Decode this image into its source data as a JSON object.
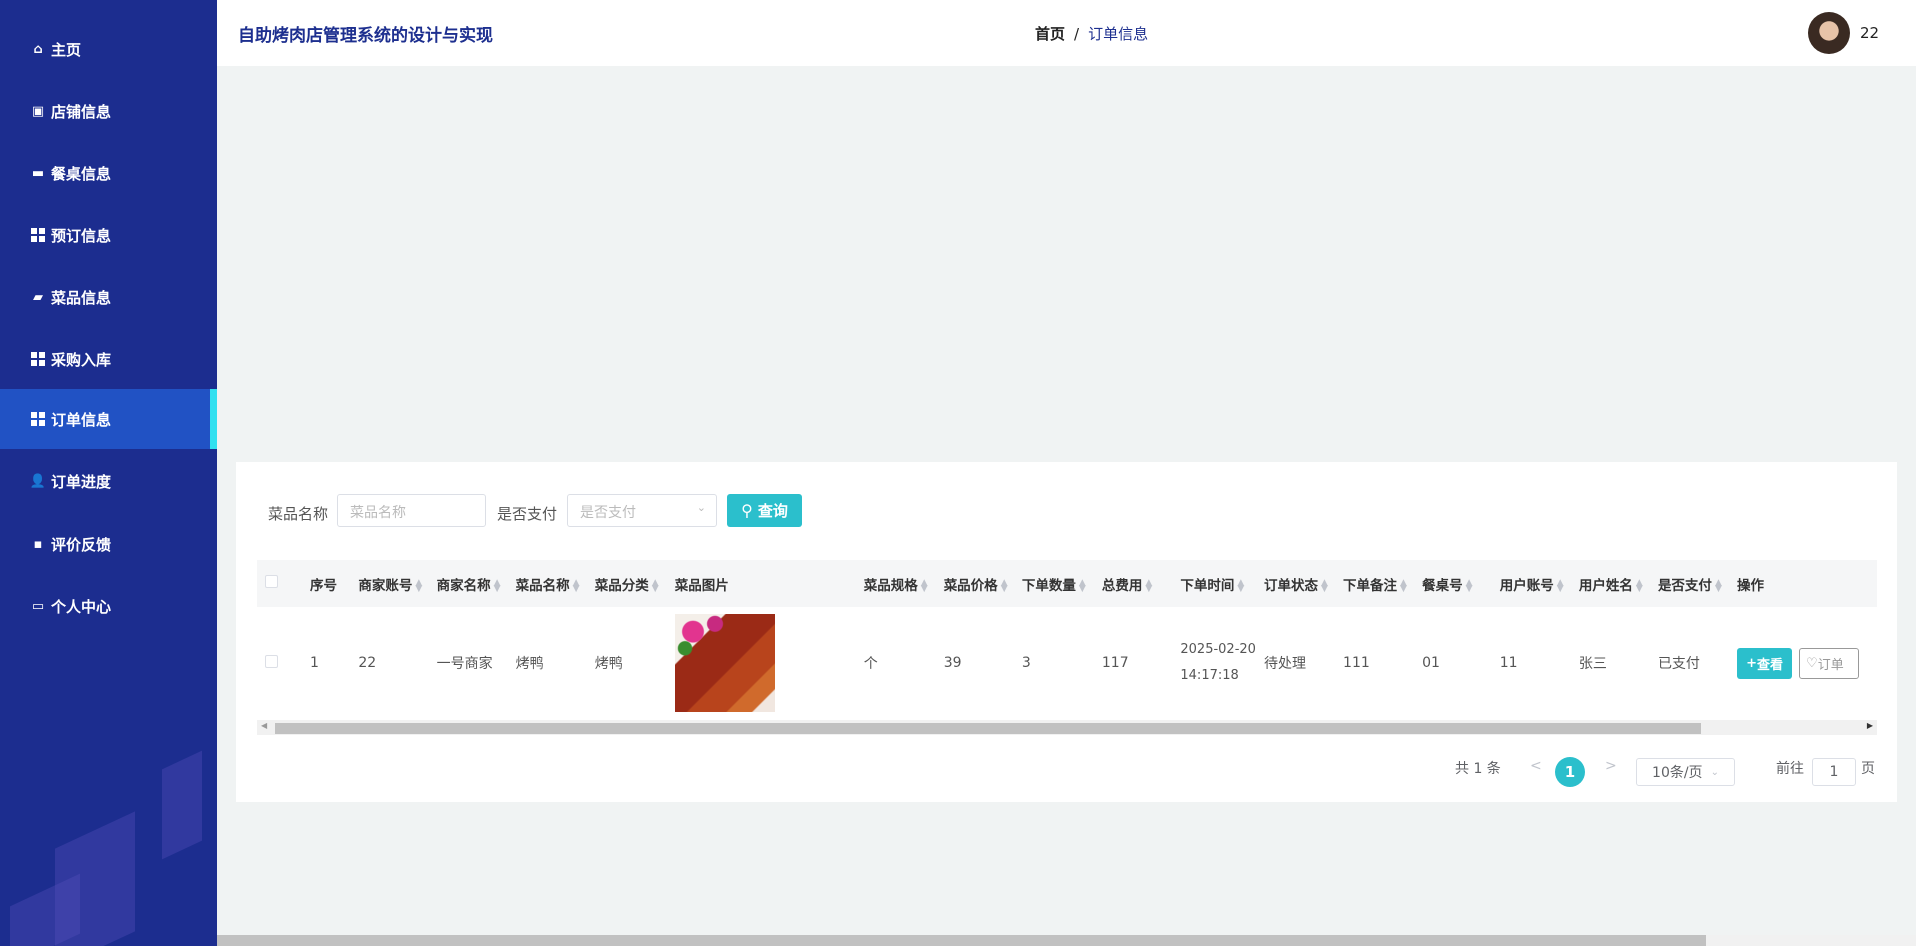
{
  "sidebar": {
    "items": [
      {
        "label": "主页",
        "icon": "home-icon"
      },
      {
        "label": "店铺信息",
        "icon": "store-icon"
      },
      {
        "label": "餐桌信息",
        "icon": "monitor-icon"
      },
      {
        "label": "预订信息",
        "icon": "grid-icon"
      },
      {
        "label": "菜品信息",
        "icon": "ticket-icon"
      },
      {
        "label": "采购入库",
        "icon": "grid-icon"
      },
      {
        "label": "订单信息",
        "icon": "grid-icon",
        "active": true
      },
      {
        "label": "订单进度",
        "icon": "user-icon"
      },
      {
        "label": "评价反馈",
        "icon": "comment-icon"
      },
      {
        "label": "个人中心",
        "icon": "card-icon"
      }
    ]
  },
  "header": {
    "title": "自助烤肉店管理系统的设计与实现",
    "breadcrumb": {
      "home": "首页",
      "separator": "/",
      "current": "订单信息"
    },
    "username": "22"
  },
  "search": {
    "name_label": "菜品名称",
    "name_placeholder": "菜品名称",
    "paid_label": "是否支付",
    "paid_placeholder": "是否支付",
    "query_label": "查询"
  },
  "table": {
    "columns": [
      "序号",
      "商家账号",
      "商家名称",
      "菜品名称",
      "菜品分类",
      "菜品图片",
      "菜品规格",
      "菜品价格",
      "下单数量",
      "总费用",
      "下单时间",
      "订单状态",
      "下单备注",
      "餐桌号",
      "用户账号",
      "用户姓名",
      "是否支付",
      "操作"
    ],
    "rows": [
      {
        "index": "1",
        "merchant_account": "22",
        "merchant_name": "一号商家",
        "dish_name": "烤鸭",
        "dish_category": "烤鸭",
        "dish_spec": "个",
        "price": "39",
        "quantity": "3",
        "total": "117",
        "order_date": "2025-02-20",
        "order_time": "14:17:18",
        "status": "待处理",
        "remark": "111",
        "table_no": "01",
        "user_account": "11",
        "user_name": "张三",
        "paid": "已支付",
        "view_label": "查看",
        "order_label": "订单"
      }
    ]
  },
  "pagination": {
    "total": "共 1 条",
    "prev": "<",
    "current": "1",
    "next": ">",
    "page_size": "10条/页",
    "goto_label": "前往",
    "goto_value": "1",
    "page_suffix": "页"
  },
  "colors": {
    "sidebar": "#1c2d8f",
    "active": "#2152c4",
    "accent": "#2bbfcc"
  }
}
